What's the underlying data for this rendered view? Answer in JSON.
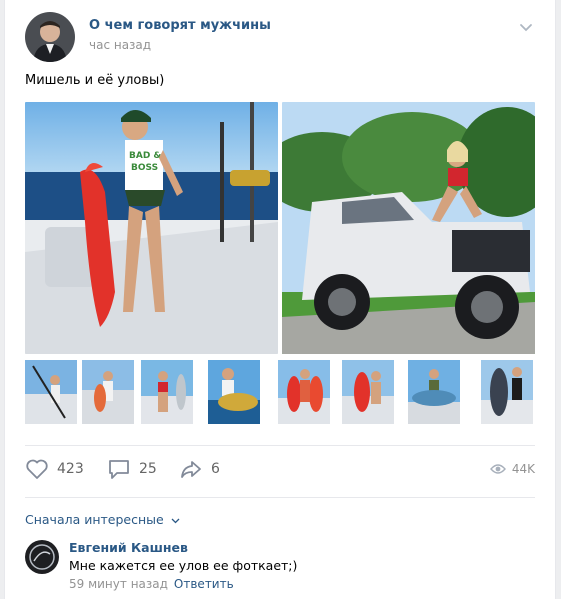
{
  "post": {
    "group_name": "О чем говорят мужчины",
    "time": "час назад",
    "text": "Мишель и её уловы)"
  },
  "photo_text": {
    "tank_top": "BAD &",
    "tank_top_2": "BOSS"
  },
  "actions": {
    "likes": "423",
    "comments": "25",
    "shares": "6",
    "views": "44K"
  },
  "comments": {
    "sort_label": "Сначала интересные",
    "items": [
      {
        "author": "Евгений Кашнев",
        "text": "Мне кажется ее улов ее фоткает;)",
        "time": "59 минут назад",
        "reply": "Ответить"
      }
    ]
  },
  "colors": {
    "link": "#2a5885",
    "muted": "#939393",
    "background": "#edeef0"
  },
  "icons": [
    "chevron-down-icon",
    "heart-icon",
    "comment-icon",
    "share-icon",
    "eye-icon"
  ]
}
